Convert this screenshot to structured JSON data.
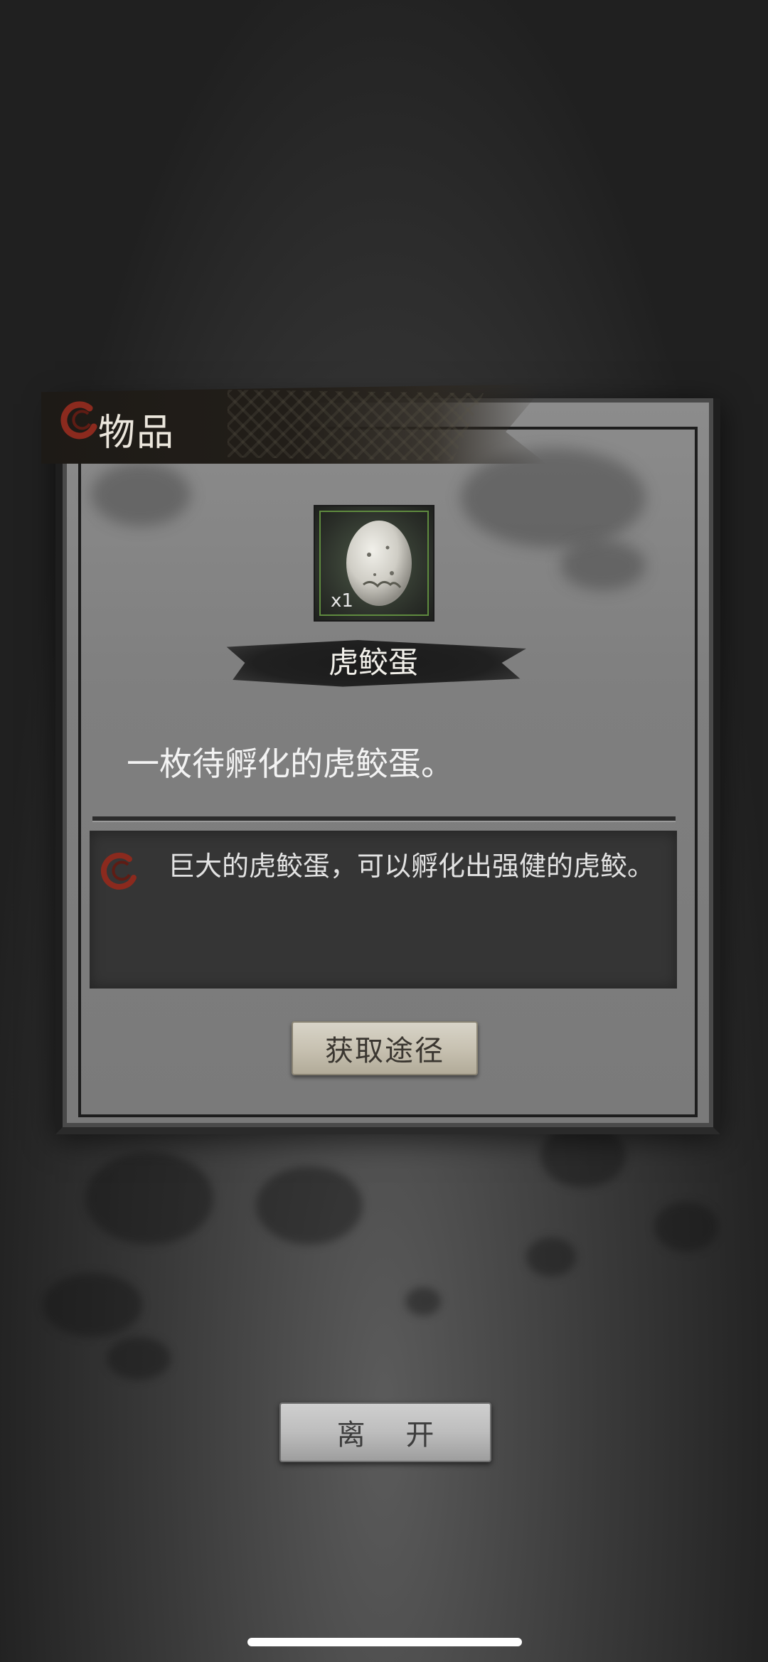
{
  "panel": {
    "title": "物品",
    "title_icon": "ink-swirl-logo-icon"
  },
  "item": {
    "icon": "egg-icon",
    "count": "x1",
    "name": "虎鲛蛋",
    "short_desc": "一枚待孵化的虎鲛蛋。",
    "detail_icon": "ink-swirl-logo-icon",
    "detail_desc": "巨大的虎鲛蛋，可以孵化出强健的虎鲛。"
  },
  "buttons": {
    "source": "获取途径",
    "leave": "离 开"
  },
  "colors": {
    "accent_red": "#8b2a1e",
    "frame_green": "#5f8b3f"
  }
}
